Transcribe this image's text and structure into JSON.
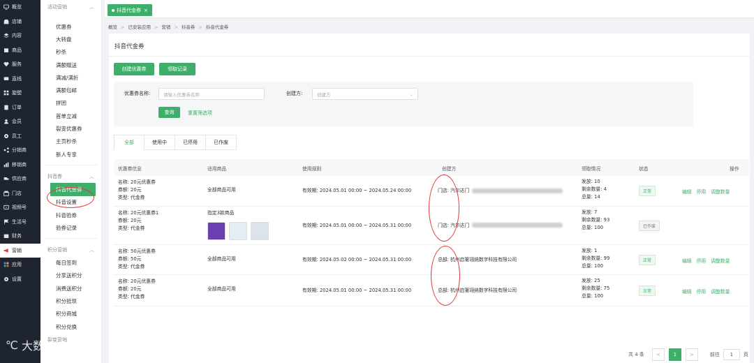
{
  "nav": [
    {
      "label": "概览",
      "icon": "monitor-icon"
    },
    {
      "label": "店铺",
      "icon": "shop-icon"
    },
    {
      "label": "内容",
      "icon": "layers-icon"
    },
    {
      "label": "商品",
      "icon": "box-icon"
    },
    {
      "label": "服务",
      "icon": "heart-icon"
    },
    {
      "label": "直线",
      "icon": "chat-icon"
    },
    {
      "label": "旋塑",
      "icon": "grid-icon"
    },
    {
      "label": "订单",
      "icon": "list-icon"
    },
    {
      "label": "会员",
      "icon": "user-icon"
    },
    {
      "label": "员工",
      "icon": "gear-icon"
    },
    {
      "label": "分销商",
      "icon": "share-icon"
    },
    {
      "label": "移销商",
      "icon": "chart-icon"
    },
    {
      "label": "供应商",
      "icon": "truck-icon"
    },
    {
      "label": "门店",
      "icon": "store-icon"
    },
    {
      "label": "视频号",
      "icon": "video-icon"
    },
    {
      "label": "生活号",
      "icon": "flag-icon"
    },
    {
      "label": "财务",
      "icon": "wallet-icon"
    },
    {
      "label": "营销",
      "icon": "megaphone-icon"
    },
    {
      "label": "应用",
      "icon": "apps-icon"
    },
    {
      "label": "设置",
      "icon": "settings-icon"
    }
  ],
  "nav_active_index": 17,
  "submenu": {
    "group1": {
      "title": "活动营销",
      "items": [
        "优惠券",
        "大转盘",
        "秒杀",
        "满额赠送",
        "满减/满折",
        "满额包邮",
        "拼团",
        "首单立减",
        "裂变优惠券",
        "主页秒杀",
        "新人专享"
      ]
    },
    "group2": {
      "title": "抖音券",
      "items": [
        "抖音代金券",
        "抖音设置",
        "抖音验券",
        "验券记录"
      ]
    },
    "group3": {
      "title": "积分营销",
      "items": [
        "每日签到",
        "分享送积分",
        "消费送积分",
        "积分抵现",
        "积分商城",
        "积分兑换"
      ]
    },
    "group4": {
      "title": "裂变营销"
    }
  },
  "tab": {
    "label": "抖音代金券",
    "close": "×"
  },
  "breadcrumb": [
    "概览",
    "已安装应用",
    "营销",
    "抖音券",
    "抖音代金券"
  ],
  "page_title": "抖音代金券",
  "buttons": {
    "create": "创建优惠券",
    "records": "领取记录"
  },
  "filter": {
    "name_label": "优惠券名称:",
    "name_placeholder": "请输入优惠券名称",
    "creator_label": "创建方:",
    "creator_placeholder": "创建方",
    "query": "查询",
    "reset": "重置筛选项"
  },
  "status_tabs": [
    "全部",
    "使用中",
    "已停用",
    "已作废"
  ],
  "columns": [
    "优惠券信息",
    "适用商品",
    "使用规则",
    "创建方",
    "领取情况",
    "状态",
    "操作"
  ],
  "rows": [
    {
      "name": "名称: 20元优惠券",
      "amount": "券额: 20元",
      "type": "类型: 代金券",
      "goods": "全部商品可用",
      "rule": "有效期: 2024.05.01 00:00 ~ 2024.05.24 00:00",
      "creator": "门店: 汽尔达门",
      "creator_hidden": true,
      "issued": "发放: 10",
      "remain": "剩余数量: 4",
      "total": "总量: 14",
      "status": "正常",
      "ops": [
        "编辑",
        "停用",
        "调整数量"
      ]
    },
    {
      "name": "名称: 20元优惠券1",
      "amount": "券额: 20元",
      "type": "类型: 代金券",
      "goods": "指定3款商品",
      "rule": "有效期: 2024.05.01 00:00 ~ 2024.05.31 00:00",
      "creator": "门店: 汽尔达门",
      "creator_hidden": true,
      "issued": "发放: 7",
      "remain": "剩余数量: 93",
      "total": "总量: 100",
      "status": "已作废",
      "ops": []
    },
    {
      "name": "名称: 50元优惠券",
      "amount": "券额: 50元",
      "type": "类型: 代金券",
      "goods": "全部商品可用",
      "rule": "有效期: 2024.05.02 00:00 ~ 2024.05.31 00:00",
      "creator": "总部: 杭州启箸翊纳数字科技有限公司",
      "creator_hidden": false,
      "issued": "发放: 1",
      "remain": "剩余数量: 99",
      "total": "总量: 100",
      "status": "正常",
      "ops": [
        "编辑",
        "停用",
        "调整数量"
      ]
    },
    {
      "name": "名称: 20元优惠券",
      "amount": "券额: 20元",
      "type": "类型: 代金券",
      "goods": "全部商品可用",
      "rule": "有效期: 2024.05.01 00:00 ~ 2024.05.31 00:00",
      "creator": "总部: 杭州启箸翊纳数字科技有限公司",
      "creator_hidden": false,
      "issued": "发放: 25",
      "remain": "剩余数量: 75",
      "total": "总量: 100",
      "status": "正常",
      "ops": [
        "编辑",
        "停用",
        "调整数量"
      ]
    }
  ],
  "pagination": {
    "total": "共 4 条",
    "prev": "<",
    "page": "1",
    "next": ">",
    "goto_label": "前往",
    "goto_value": "1",
    "goto_unit": "页"
  },
  "watermark": "大数跨境",
  "colors": {
    "accent": "#3fae6a",
    "nav_bg": "#1f2530",
    "annotation": "#e23b3b"
  }
}
